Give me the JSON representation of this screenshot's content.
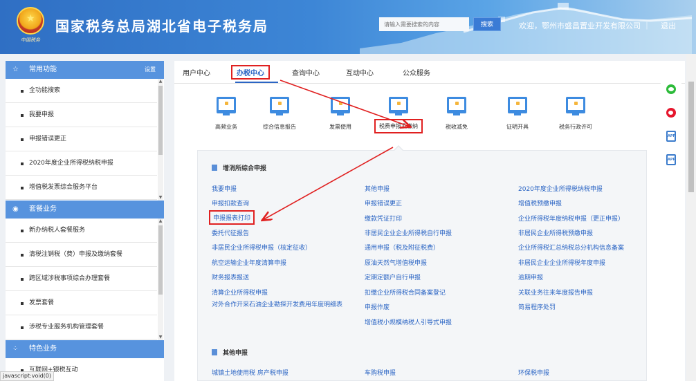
{
  "header": {
    "logo_text": "中国税务",
    "title": "国家税务总局湖北省电子税务局",
    "search_placeholder": "请输入需要搜索的内容",
    "search_label": "搜索",
    "welcome": "欢迎，鄂州市盛昌置业开发有限公司 ｜",
    "logout": "退出"
  },
  "sidebar": {
    "common": {
      "title": "常用功能",
      "setting": "设置",
      "items": [
        "全功能搜索",
        "我要申报",
        "申报错误更正",
        "2020年度企业所得税纳税申报",
        "增值税发票综合服务平台"
      ]
    },
    "package": {
      "title": "套餐业务",
      "items": [
        "新办纳税人套餐服务",
        "清税注销税（费）申报及缴纳套餐",
        "跨区域涉税事项综合办理套餐",
        "发票套餐",
        "涉税专业服务机构管理套餐"
      ]
    },
    "special": {
      "title": "特色业务",
      "items": [
        "互联网+银税互动"
      ]
    }
  },
  "status_bar": "javascript:void(0)",
  "tabs": [
    "用户中心",
    "办税中心",
    "查询中心",
    "互动中心",
    "公众服务"
  ],
  "categories": [
    "高频业务",
    "综合信息报告",
    "发票使用",
    "税费申报及缴纳",
    "税收减免",
    "证明开具",
    "税务行政许可"
  ],
  "group1": {
    "title": "增消所综合申报",
    "col1": [
      "我要申报",
      "申报扣款查询",
      "申报报表打印",
      "委托代征报告",
      "非居民企业所得税申报（核定征收）",
      "航空运输企业年度清算申报",
      "财务报表报送",
      "清算企业所得税申报",
      "对外合作开采石油企业勘探开发费用年度明细表"
    ],
    "col2": [
      "其他申报",
      "申报错误更正",
      "缴款凭证打印",
      "非居民企业企业所得税自行申报",
      "通用申报（税及附征税费）",
      "原油天然气增值税申报",
      "定期定额户自行申报",
      "扣缴企业所得税合同备案登记",
      "申报作废",
      "增值税小规模纳税人引导式申报"
    ],
    "col3": [
      "2020年度企业所得税纳税申报",
      "增值税预缴申报",
      "企业所得税年度纳税申报（更正申报）",
      "非居民企业所得税预缴申报",
      "企业所得税汇总纳税总分机构信息备案",
      "非居民企业企业所得税年度申报",
      "逾期申报",
      "关联业务往来年度报告申报",
      "简易程序处罚"
    ]
  },
  "group2": {
    "title": "其他申报",
    "links": [
      "城镇土地使用税 房产税申报",
      "车购税申报",
      "环保税申报"
    ]
  },
  "float_icons": [
    "wechat-icon",
    "weibo-icon",
    "app-icon",
    "app-icon"
  ],
  "colors": {
    "accent": "#2b65c4",
    "header": "#3d86d6",
    "sidebar_head": "#5793de",
    "highlight": "#e02020"
  }
}
